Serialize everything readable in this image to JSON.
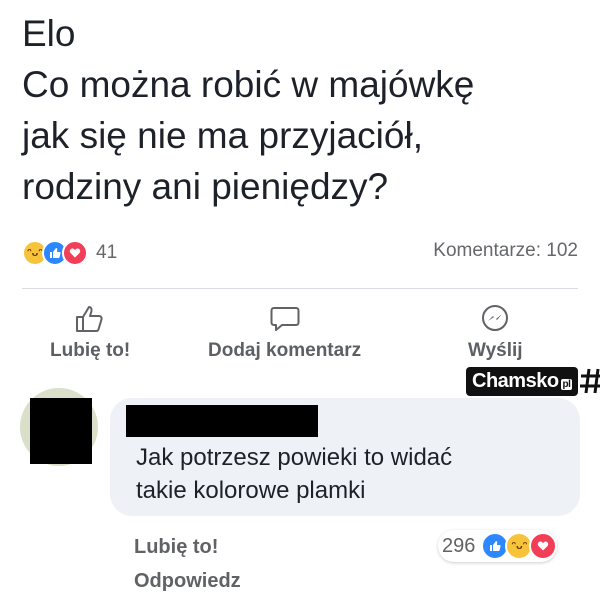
{
  "post": {
    "text": "Elo\nCo można robić w majówkę\njak się nie ma przyjaciół,\nrodziny ani pieniędzy?",
    "reaction_count": "41",
    "comments_count": "Komentarze: 102"
  },
  "actions": {
    "like": "Lubię to!",
    "comment": "Dodaj komentarz",
    "share": "Wyślij"
  },
  "watermark": {
    "text": "Chamsko",
    "suffix": "pl"
  },
  "comment": {
    "text": "Jak potrzesz powieki to widać\ntakie kolorowe plamki",
    "like": "Lubię to!",
    "reply": "Odpowiedz",
    "reaction_count": "296"
  },
  "icons": {
    "post_reactions": [
      "haha-icon",
      "like-icon",
      "love-icon"
    ],
    "comment_reactions": [
      "like-icon",
      "haha-icon",
      "love-icon"
    ]
  },
  "colors": {
    "like": "#2d88ff",
    "love": "#f33e58",
    "haha": "#f7c33a"
  }
}
